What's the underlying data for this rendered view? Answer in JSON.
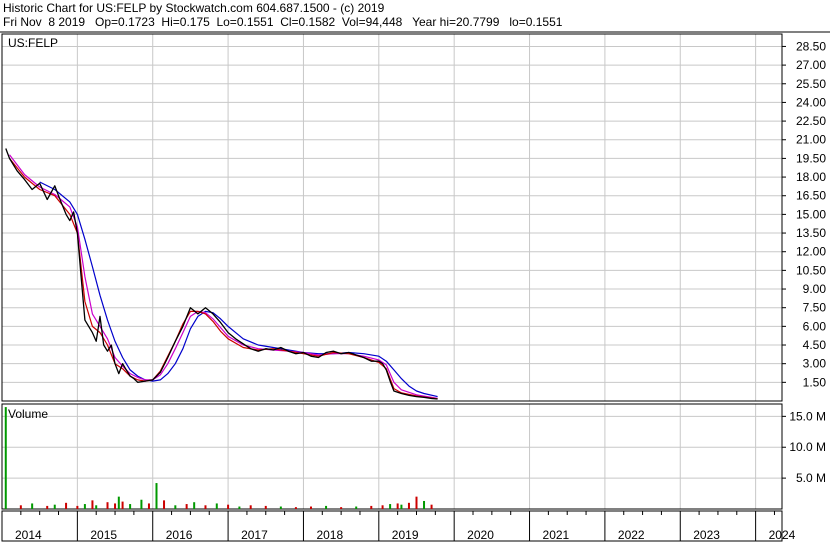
{
  "header": {
    "title": "Historic Chart for US:FELP by Stockwatch.com 604.687.1500 - (c) 2019",
    "quote": "Fri Nov  8 2019   Op=0.1723  Hi=0.175  Lo=0.1551  Cl=0.1582  Vol=94,448   Year hi=20.7799   lo=0.1551"
  },
  "chart": {
    "symbol_label": "US:FELP",
    "volume_label": "Volume"
  },
  "colors": {
    "price": "#000000",
    "ma_short": "#cc0000",
    "ma_mid": "#cc00cc",
    "ma_long": "#0000cc",
    "vol_up": "#009900",
    "vol_down": "#cc0000",
    "grid": "#c8c8c8"
  },
  "chart_data": {
    "type": "line",
    "price_axis": {
      "ticks": [
        "28.50",
        "27.00",
        "25.50",
        "24.00",
        "22.50",
        "21.00",
        "19.50",
        "18.00",
        "16.50",
        "15.00",
        "13.50",
        "12.00",
        "10.50",
        "9.00",
        "7.50",
        "6.00",
        "4.50",
        "3.00",
        "1.50"
      ],
      "ylim": [
        0,
        29.5
      ]
    },
    "volume_axis": {
      "ticks": [
        "15.0 M",
        "10.0 M",
        "5.0 M"
      ],
      "ylim": [
        0,
        17
      ]
    },
    "x_axis": {
      "ticks": [
        "2014",
        "2015",
        "2016",
        "2017",
        "2018",
        "2019",
        "2020",
        "2021",
        "2022",
        "2023",
        "2024"
      ],
      "xlim": [
        2014.0,
        2024.35
      ]
    },
    "series": [
      {
        "name": "price",
        "x": [
          2014.05,
          2014.1,
          2014.2,
          2014.3,
          2014.4,
          2014.5,
          2014.6,
          2014.7,
          2014.75,
          2014.85,
          2014.9,
          2014.95,
          2015.0,
          2015.05,
          2015.1,
          2015.15,
          2015.2,
          2015.25,
          2015.3,
          2015.35,
          2015.4,
          2015.45,
          2015.5,
          2015.55,
          2015.6,
          2015.65,
          2015.7,
          2015.75,
          2015.8,
          2015.9,
          2016.0,
          2016.1,
          2016.2,
          2016.3,
          2016.4,
          2016.5,
          2016.6,
          2016.7,
          2016.8,
          2016.9,
          2017.0,
          2017.1,
          2017.2,
          2017.3,
          2017.4,
          2017.5,
          2017.6,
          2017.7,
          2017.8,
          2017.9,
          2018.0,
          2018.1,
          2018.2,
          2018.3,
          2018.4,
          2018.5,
          2018.6,
          2018.7,
          2018.8,
          2018.9,
          2019.0,
          2019.05,
          2019.1,
          2019.15,
          2019.2,
          2019.3,
          2019.4,
          2019.5,
          2019.6,
          2019.7,
          2019.78
        ],
        "y": [
          20.3,
          19.5,
          18.5,
          17.8,
          17.0,
          17.5,
          16.2,
          17.3,
          16.5,
          15.0,
          14.5,
          15.2,
          13.5,
          10.0,
          6.5,
          6.0,
          5.5,
          4.8,
          6.8,
          4.5,
          4.0,
          4.5,
          3.0,
          2.2,
          3.0,
          2.5,
          2.0,
          1.8,
          1.5,
          1.6,
          1.7,
          2.3,
          3.5,
          4.8,
          6.0,
          7.5,
          7.0,
          7.5,
          7.0,
          6.3,
          5.5,
          5.0,
          4.6,
          4.2,
          4.0,
          4.2,
          4.1,
          4.3,
          4.0,
          3.8,
          3.9,
          3.6,
          3.5,
          3.9,
          4.0,
          3.8,
          3.9,
          3.7,
          3.5,
          3.2,
          3.2,
          3.0,
          2.5,
          1.6,
          0.8,
          0.6,
          0.45,
          0.35,
          0.3,
          0.2,
          0.16
        ]
      },
      {
        "name": "ma_short",
        "x": [
          2014.1,
          2014.3,
          2014.5,
          2014.7,
          2014.9,
          2015.0,
          2015.1,
          2015.2,
          2015.3,
          2015.4,
          2015.5,
          2015.6,
          2015.7,
          2015.8,
          2015.9,
          2016.0,
          2016.1,
          2016.2,
          2016.3,
          2016.4,
          2016.5,
          2016.6,
          2016.7,
          2016.8,
          2016.9,
          2017.0,
          2017.2,
          2017.4,
          2017.6,
          2017.8,
          2018.0,
          2018.2,
          2018.4,
          2018.6,
          2018.8,
          2019.0,
          2019.1,
          2019.2,
          2019.3,
          2019.5,
          2019.78
        ],
        "y": [
          19.5,
          18.0,
          17.0,
          16.5,
          15.0,
          13.5,
          8.0,
          6.0,
          5.5,
          4.5,
          3.0,
          2.6,
          2.0,
          1.7,
          1.6,
          1.7,
          2.4,
          3.6,
          4.8,
          6.2,
          7.2,
          7.2,
          7.0,
          6.4,
          5.6,
          5.0,
          4.3,
          4.1,
          4.2,
          4.0,
          3.8,
          3.6,
          3.9,
          3.8,
          3.5,
          3.1,
          2.6,
          1.0,
          0.65,
          0.4,
          0.18
        ]
      },
      {
        "name": "ma_mid",
        "x": [
          2014.1,
          2014.3,
          2014.5,
          2014.7,
          2014.9,
          2015.0,
          2015.1,
          2015.2,
          2015.3,
          2015.4,
          2015.5,
          2015.6,
          2015.7,
          2015.8,
          2015.9,
          2016.0,
          2016.1,
          2016.2,
          2016.3,
          2016.4,
          2016.5,
          2016.6,
          2016.7,
          2016.8,
          2016.9,
          2017.0,
          2017.2,
          2017.4,
          2017.6,
          2017.8,
          2018.0,
          2018.2,
          2018.4,
          2018.6,
          2018.8,
          2019.0,
          2019.1,
          2019.2,
          2019.3,
          2019.5,
          2019.78
        ],
        "y": [
          19.8,
          18.2,
          17.2,
          16.6,
          15.6,
          14.0,
          10.0,
          7.0,
          6.0,
          5.0,
          3.5,
          2.8,
          2.2,
          1.9,
          1.7,
          1.7,
          2.1,
          3.0,
          4.2,
          5.5,
          6.8,
          7.2,
          7.1,
          6.6,
          5.9,
          5.2,
          4.5,
          4.2,
          4.1,
          4.0,
          3.9,
          3.7,
          3.8,
          3.8,
          3.6,
          3.3,
          2.9,
          1.5,
          0.9,
          0.5,
          0.22
        ]
      },
      {
        "name": "ma_long",
        "x": [
          2014.5,
          2014.7,
          2014.9,
          2015.0,
          2015.1,
          2015.2,
          2015.3,
          2015.4,
          2015.5,
          2015.6,
          2015.7,
          2015.8,
          2015.9,
          2016.0,
          2016.1,
          2016.2,
          2016.3,
          2016.4,
          2016.5,
          2016.6,
          2016.7,
          2016.8,
          2016.9,
          2017.0,
          2017.2,
          2017.4,
          2017.6,
          2017.8,
          2018.0,
          2018.2,
          2018.4,
          2018.6,
          2018.8,
          2019.0,
          2019.1,
          2019.2,
          2019.3,
          2019.4,
          2019.5,
          2019.6,
          2019.78
        ],
        "y": [
          17.6,
          17.0,
          16.0,
          15.0,
          13.0,
          10.8,
          8.5,
          6.5,
          4.8,
          3.5,
          2.5,
          2.0,
          1.7,
          1.6,
          1.7,
          2.2,
          3.0,
          4.2,
          5.8,
          6.8,
          7.2,
          7.1,
          6.6,
          6.0,
          5.0,
          4.5,
          4.3,
          4.1,
          3.9,
          3.8,
          3.8,
          3.9,
          3.8,
          3.6,
          3.2,
          2.5,
          1.8,
          1.2,
          0.8,
          0.6,
          0.35
        ]
      }
    ],
    "volume": {
      "x": [
        2014.05,
        2014.25,
        2014.4,
        2014.6,
        2014.7,
        2014.85,
        2015.0,
        2015.1,
        2015.2,
        2015.25,
        2015.4,
        2015.5,
        2015.55,
        2015.6,
        2015.7,
        2015.85,
        2015.95,
        2016.05,
        2016.15,
        2016.3,
        2016.45,
        2016.55,
        2016.7,
        2016.85,
        2017.0,
        2017.15,
        2017.3,
        2017.5,
        2017.7,
        2017.9,
        2018.1,
        2018.3,
        2018.5,
        2018.7,
        2018.9,
        2019.05,
        2019.15,
        2019.25,
        2019.3,
        2019.4,
        2019.5,
        2019.6,
        2019.7
      ],
      "y": [
        16.5,
        0.6,
        0.9,
        0.5,
        0.7,
        1.0,
        0.5,
        0.8,
        1.4,
        0.6,
        1.1,
        0.9,
        2.0,
        1.2,
        0.8,
        1.5,
        0.9,
        4.2,
        1.4,
        0.6,
        0.8,
        1.1,
        0.6,
        0.9,
        0.7,
        0.4,
        0.6,
        0.5,
        0.4,
        0.3,
        0.4,
        0.5,
        0.3,
        0.4,
        0.5,
        0.6,
        0.8,
        0.9,
        0.7,
        1.0,
        2.0,
        1.3,
        0.7
      ],
      "up": [
        true,
        false,
        true,
        false,
        true,
        false,
        false,
        true,
        false,
        true,
        false,
        false,
        true,
        false,
        true,
        true,
        false,
        true,
        false,
        true,
        false,
        true,
        false,
        true,
        false,
        true,
        false,
        false,
        true,
        false,
        false,
        true,
        false,
        true,
        false,
        false,
        true,
        false,
        true,
        false,
        false,
        true,
        false
      ]
    }
  }
}
